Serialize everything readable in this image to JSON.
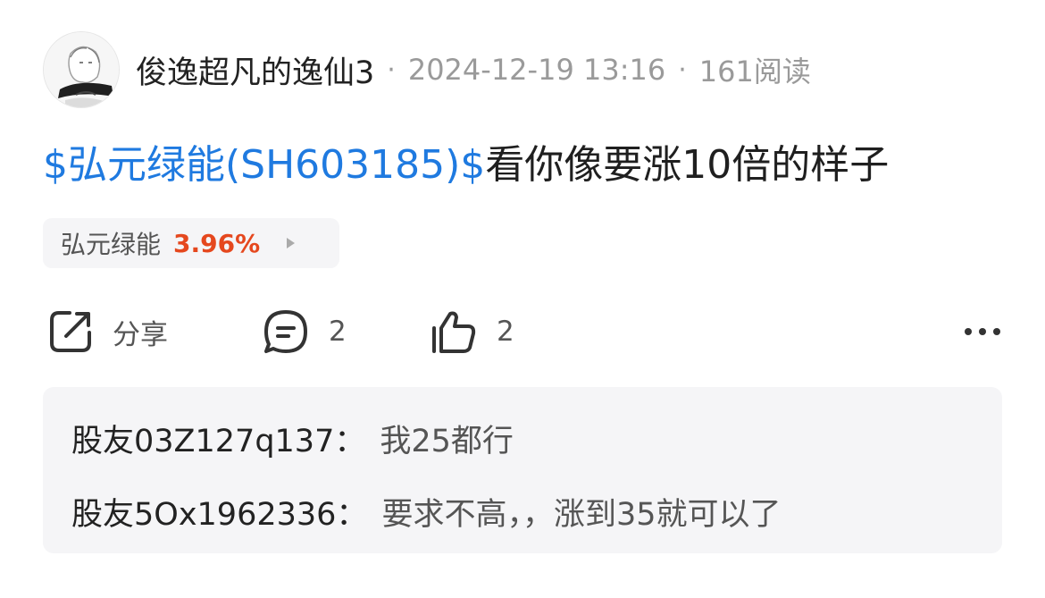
{
  "post": {
    "author": "俊逸超凡的逸仙3",
    "date": "2024-12-19 13:16",
    "reads": "161阅读",
    "title_link": "$弘元绿能(SH603185)$",
    "title_text": "看你像要涨10倍的样子"
  },
  "stock_chip": {
    "name": "弘元绿能",
    "change": "3.96%",
    "change_color": "#e5481e"
  },
  "actions": {
    "share_label": "分享",
    "comment_count": "2",
    "like_count": "2",
    "icons": [
      "share-icon",
      "comment-icon",
      "like-icon",
      "more-icon"
    ]
  },
  "comments": [
    {
      "author": "股友03Z127q137",
      "colon": "：",
      "text": "我25都行"
    },
    {
      "author": "股友5Ox1962336",
      "colon": "：",
      "text": "要求不高，，涨到35就可以了"
    }
  ],
  "colors": {
    "link": "#1f7ae0",
    "muted": "#9a9a9a",
    "panel": "#f5f5f7"
  }
}
